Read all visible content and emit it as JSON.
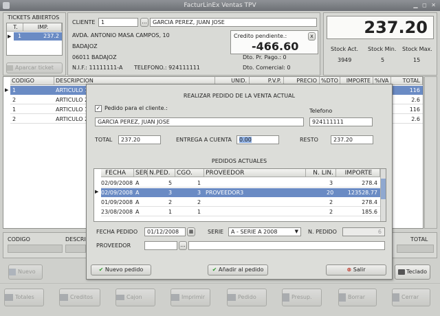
{
  "window": {
    "title": "FacturLinEx Ventas TPV"
  },
  "tickets": {
    "title": "TICKETS ABIERTOS",
    "headers": [
      "T.",
      "IMP."
    ],
    "rows": [
      {
        "t": "1",
        "imp": "237.2"
      }
    ],
    "open_button": "Aparcar ticket"
  },
  "client": {
    "label": "CLIENTE",
    "code": "1",
    "name": "GARCIA PEREZ, JUAN JOSE",
    "address": "AVDA. ANTONIO MASA CAMPOS, 10",
    "city": "BADAJOZ",
    "zip_city": "06011  BADAJOZ",
    "nif": "N.I.F.: 11111111-A",
    "phone": "TELEFONO.: 924111111",
    "credit_label": "Credito pendiente.:",
    "credit_value": "-466.60",
    "close_x": "x",
    "dto_pago": "Dto. Pr. Pago.:  0",
    "dto_comercial": "Dto. Comercial:  0"
  },
  "total_display": "237.20",
  "stock": {
    "headers": [
      "Stock Act.",
      "Stock Min.",
      "Stock Max."
    ],
    "values": [
      "3949",
      "5",
      "15"
    ]
  },
  "lines": {
    "headers": [
      "CODIGO",
      "DESCRIPCION",
      "UNID.",
      "P.V.P.",
      "PRECIO",
      "%DTO",
      "IMPORTE",
      "%IVA",
      "TOTAL"
    ],
    "rows": [
      {
        "code": "1",
        "desc": "ARTICULO 1",
        "total": "116"
      },
      {
        "code": "2",
        "desc": "ARTICULO 2",
        "total": "2.6"
      },
      {
        "code": "1",
        "desc": "ARTICULO 1",
        "total": "116"
      },
      {
        "code": "2",
        "desc": "ARTICULO 2",
        "total": "2.6"
      }
    ]
  },
  "bottom_inputs": {
    "codigo": "CODIGO",
    "descripcion": "DESCRIPC",
    "total": "TOTAL"
  },
  "buttons": {
    "nuevo": "Nuevo",
    "teclado": "Teclado",
    "footer": [
      "Totales",
      "Creditos",
      "Cajon",
      "Imprimir",
      "Pedido",
      "Presup.",
      "Borrar",
      "Cerrar"
    ]
  },
  "dialog": {
    "title": "REALIZAR PEDIDO DE LA VENTA ACTUAL",
    "check_label": "Pedido para el cliente.:",
    "client_name": "GARCIA PEREZ, JUAN JOSE",
    "phone_label": "Telefono",
    "phone_value": "924111111",
    "total_label": "TOTAL",
    "total_value": "237.20",
    "entrega_label": "ENTREGA A CUENTA",
    "entrega_value": "0.00",
    "resto_label": "RESTO",
    "resto_value": "237.20",
    "pedidos_title": "PEDIDOS ACTUALES",
    "pedidos_headers": [
      "FECHA",
      "SER",
      "N.PED.",
      "CGO.",
      "PROVEEDOR",
      "N. LIN.",
      "IMPORTE"
    ],
    "pedidos_rows": [
      {
        "fecha": "02/09/2008",
        "ser": "A",
        "nped": "5",
        "cgo": "1",
        "prov": "",
        "nlin": "3",
        "importe": "278.4"
      },
      {
        "fecha": "02/09/2008",
        "ser": "A",
        "nped": "3",
        "cgo": "3",
        "prov": "PROVEEDOR3",
        "nlin": "20",
        "importe": "123528.77"
      },
      {
        "fecha": "01/09/2008",
        "ser": "A",
        "nped": "2",
        "cgo": "2",
        "prov": "",
        "nlin": "2",
        "importe": "278.4"
      },
      {
        "fecha": "23/08/2008",
        "ser": "A",
        "nped": "1",
        "cgo": "1",
        "prov": "",
        "nlin": "2",
        "importe": "185.6"
      }
    ],
    "fecha_pedido_label": "FECHA PEDIDO",
    "fecha_pedido_value": "01/12/2008",
    "serie_label": "SERIE",
    "serie_value": "A - SERIE A 2008",
    "npedido_label": "N. PEDIDO",
    "npedido_value": "6",
    "proveedor_label": "PROVEEDOR",
    "proveedor_code": "",
    "proveedor_name": "",
    "nuevo_pedido": "Nuevo pedido",
    "anadir": "Añadir al pedido",
    "salir": "Salir"
  },
  "colors": {
    "selection": "#6a8bc4",
    "accent_green": "#2e9b2e",
    "salir_red": "#c0392b"
  }
}
